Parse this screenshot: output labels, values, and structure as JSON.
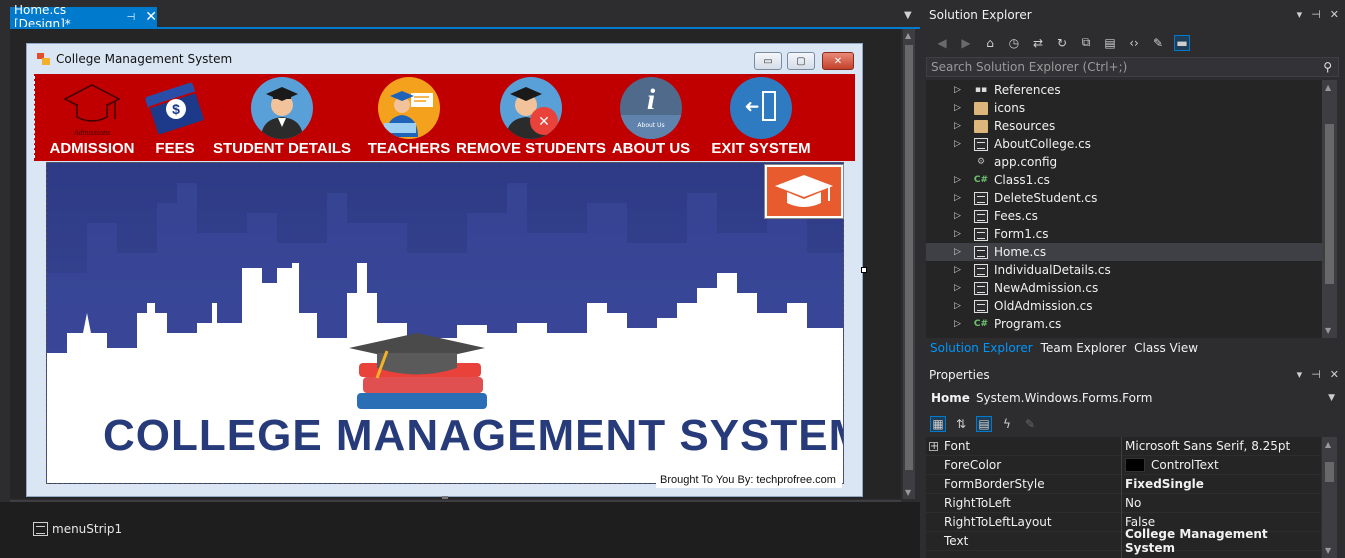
{
  "document_tab": {
    "title": "Home.cs [Design]*",
    "pin": "⊣",
    "close": "✕"
  },
  "tray": {
    "component": "menuStrip1"
  },
  "form": {
    "title": "College Management System",
    "buttons": {
      "minimize": "▭",
      "maximize": "▢",
      "close": "✕"
    },
    "menu_items": [
      {
        "label": "ADMISSION",
        "icon": "admission-cap-icon"
      },
      {
        "label": "FEES",
        "icon": "money-fees-icon"
      },
      {
        "label": "STUDENT DETAILS",
        "icon": "graduate-student-icon"
      },
      {
        "label": "TEACHERS",
        "icon": "teacher-icon"
      },
      {
        "label": "REMOVE STUDENTS",
        "icon": "remove-student-icon"
      },
      {
        "label": "ABOUT US",
        "icon": "about-info-icon"
      },
      {
        "label": "EXIT SYSTEM",
        "icon": "exit-door-icon"
      }
    ],
    "menu_icon_text": {
      "admission": "Admissions",
      "about": "About Us",
      "about_glyph": "i",
      "fees_glyph": "$",
      "remove_glyph": "✕",
      "exit_glyph": "➜"
    },
    "hero_title": "COLLEGE MANAGEMENT SYSTEM",
    "credit": "Brought To You By: techprofree.com"
  },
  "solution_explorer": {
    "title": "Solution Explorer",
    "controls": {
      "dropdown": "▾",
      "pin": "⊣",
      "close": "✕"
    },
    "search_placeholder": "Search Solution Explorer (Ctrl+;)",
    "search_icon": "🔍",
    "items": [
      {
        "label": "References",
        "icon": "references-icon",
        "expandable": true
      },
      {
        "label": "icons",
        "icon": "folder-icon",
        "expandable": true
      },
      {
        "label": "Resources",
        "icon": "folder-icon",
        "expandable": true
      },
      {
        "label": "AboutCollege.cs",
        "icon": "form-file-icon",
        "expandable": true
      },
      {
        "label": "app.config",
        "icon": "config-file-icon",
        "expandable": false
      },
      {
        "label": "Class1.cs",
        "icon": "csharp-file-icon",
        "expandable": true
      },
      {
        "label": "DeleteStudent.cs",
        "icon": "form-file-icon",
        "expandable": true
      },
      {
        "label": "Fees.cs",
        "icon": "form-file-icon",
        "expandable": true
      },
      {
        "label": "Form1.cs",
        "icon": "form-file-icon",
        "expandable": true
      },
      {
        "label": "Home.cs",
        "icon": "form-file-icon",
        "expandable": true,
        "selected": true
      },
      {
        "label": "IndividualDetails.cs",
        "icon": "form-file-icon",
        "expandable": true
      },
      {
        "label": "NewAdmission.cs",
        "icon": "form-file-icon",
        "expandable": true
      },
      {
        "label": "OldAdmission.cs",
        "icon": "form-file-icon",
        "expandable": true
      },
      {
        "label": "Program.cs",
        "icon": "csharp-file-icon",
        "expandable": true
      }
    ],
    "tabs": [
      "Solution Explorer",
      "Team Explorer",
      "Class View"
    ]
  },
  "properties": {
    "title": "Properties",
    "object_name": "Home",
    "object_type": "System.Windows.Forms.Form",
    "rows": [
      {
        "name": "Font",
        "value": "Microsoft Sans Serif, 8.25pt",
        "expandable": true,
        "bold": false
      },
      {
        "name": "ForeColor",
        "value": "ControlText",
        "swatch": "#000000",
        "bold": false
      },
      {
        "name": "FormBorderStyle",
        "value": "FixedSingle",
        "bold": true
      },
      {
        "name": "RightToLeft",
        "value": "No",
        "bold": false
      },
      {
        "name": "RightToLeftLayout",
        "value": "False",
        "bold": false
      },
      {
        "name": "Text",
        "value": "College Management System",
        "bold": true
      }
    ]
  },
  "colors": {
    "accent": "#007acc",
    "menu_strip": "#c00000",
    "hero_title": "#273b7a",
    "hat_box": "#e75b2e"
  }
}
